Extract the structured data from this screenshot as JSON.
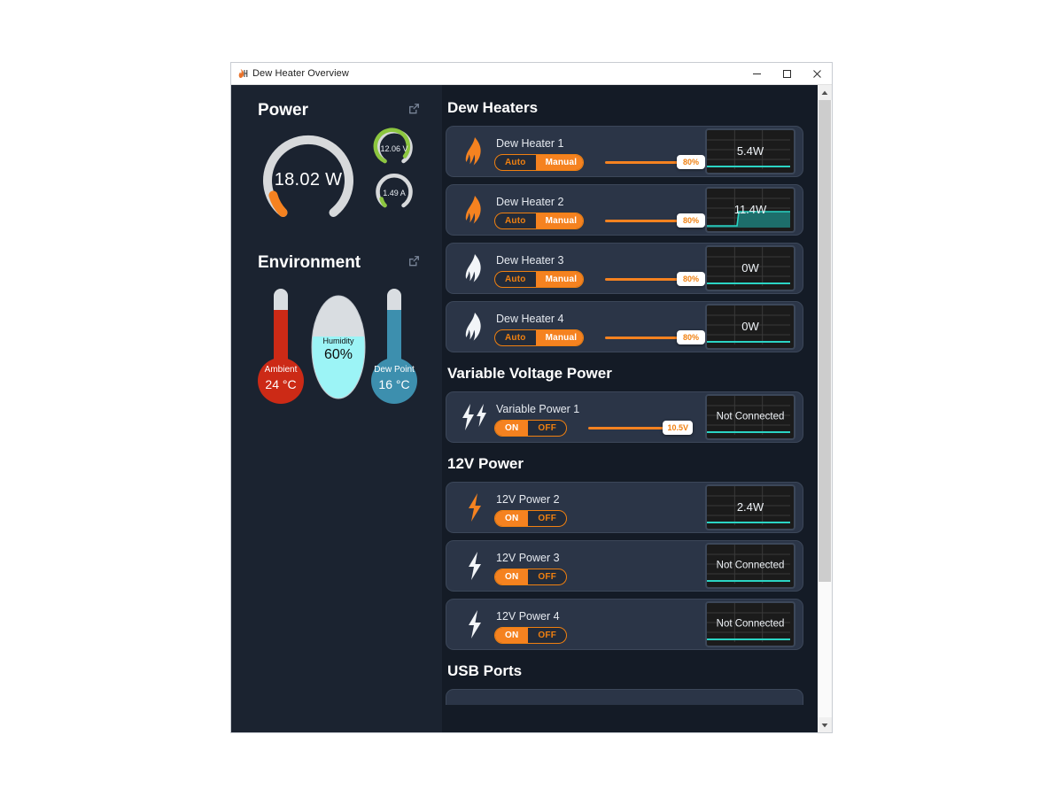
{
  "window": {
    "title": "Dew Heater Overview",
    "icon": "flame-h-icon",
    "controls": {
      "minimize": "minimize-icon",
      "maximize": "maximize-icon",
      "close": "close-icon"
    }
  },
  "left": {
    "power": {
      "title": "Power",
      "expand_icon": "external-link-icon",
      "main_gauge": {
        "value": "18.02 W",
        "percent": 14,
        "color": "#f58220",
        "track": "#d7d9db"
      },
      "sub_gauges": [
        {
          "value": "12.06 V",
          "percent": 78,
          "color": "#8cc63f",
          "track": "#d7d9db"
        },
        {
          "value": "1.49 A",
          "percent": 14,
          "color": "#8cc63f",
          "track": "#d7d9db"
        }
      ]
    },
    "environment": {
      "title": "Environment",
      "expand_icon": "external-link-icon",
      "ambient": {
        "label": "Ambient",
        "value": "24 °C",
        "color": "#cc2a16",
        "fill_percent": 72
      },
      "humidity": {
        "label": "Humidity",
        "value": "60%",
        "color": "#9cf4f6",
        "fill_percent": 60
      },
      "dewpoint": {
        "label": "Dew Point",
        "value": "16 °C",
        "color": "#3d8fae",
        "fill_percent": 72
      }
    }
  },
  "sections": [
    {
      "title": "Dew Heaters",
      "cards": [
        {
          "icon": "flame-icon",
          "icon_active": true,
          "name": "Dew Heater 1",
          "toggle": {
            "options": [
              "Auto",
              "Manual"
            ],
            "selected": "Manual"
          },
          "slider": {
            "value": "80%",
            "percent": 80
          },
          "graph": {
            "value": "5.4W",
            "shape": "flat-low"
          }
        },
        {
          "icon": "flame-icon",
          "icon_active": true,
          "name": "Dew Heater 2",
          "toggle": {
            "options": [
              "Auto",
              "Manual"
            ],
            "selected": "Manual"
          },
          "slider": {
            "value": "80%",
            "percent": 80
          },
          "graph": {
            "value": "11.4W",
            "shape": "step-up"
          }
        },
        {
          "icon": "flame-icon",
          "icon_active": false,
          "name": "Dew Heater 3",
          "toggle": {
            "options": [
              "Auto",
              "Manual"
            ],
            "selected": "Manual"
          },
          "slider": {
            "value": "80%",
            "percent": 80
          },
          "graph": {
            "value": "0W",
            "shape": "flat-low"
          }
        },
        {
          "icon": "flame-icon",
          "icon_active": false,
          "name": "Dew Heater 4",
          "toggle": {
            "options": [
              "Auto",
              "Manual"
            ],
            "selected": "Manual"
          },
          "slider": {
            "value": "80%",
            "percent": 80
          },
          "graph": {
            "value": "0W",
            "shape": "flat-low"
          }
        }
      ]
    },
    {
      "title": "Variable Voltage Power",
      "cards": [
        {
          "icon": "double-bolt-icon",
          "icon_active": false,
          "name": "Variable Power 1",
          "toggle": {
            "options": [
              "ON",
              "OFF"
            ],
            "selected": "ON"
          },
          "slider": {
            "value": "10.5V",
            "percent": 62
          },
          "graph": {
            "value": "Not Connected",
            "shape": "flat-low"
          }
        }
      ]
    },
    {
      "title": "12V Power",
      "cards": [
        {
          "icon": "bolt-icon",
          "icon_active": true,
          "name": "12V Power 2",
          "toggle": {
            "options": [
              "ON",
              "OFF"
            ],
            "selected": "ON"
          },
          "slider": null,
          "graph": {
            "value": "2.4W",
            "shape": "flat-low"
          }
        },
        {
          "icon": "bolt-icon",
          "icon_active": false,
          "name": "12V Power 3",
          "toggle": {
            "options": [
              "ON",
              "OFF"
            ],
            "selected": "ON"
          },
          "slider": null,
          "graph": {
            "value": "Not Connected",
            "shape": "flat-low"
          }
        },
        {
          "icon": "bolt-icon",
          "icon_active": false,
          "name": "12V Power 4",
          "toggle": {
            "options": [
              "ON",
              "OFF"
            ],
            "selected": "ON"
          },
          "slider": null,
          "graph": {
            "value": "Not Connected",
            "shape": "flat-low"
          }
        }
      ]
    },
    {
      "title": "USB Ports",
      "cards": [
        {
          "cut_off": true
        }
      ]
    }
  ],
  "scrollbar": {
    "up_icon": "chevron-up-icon",
    "down_icon": "chevron-down-icon",
    "thumb_percent": 78
  },
  "colors": {
    "accent": "#f58220",
    "graph_line": "#2bd4c4",
    "card_bg": "#2b3547",
    "app_bg": "#141b26"
  }
}
